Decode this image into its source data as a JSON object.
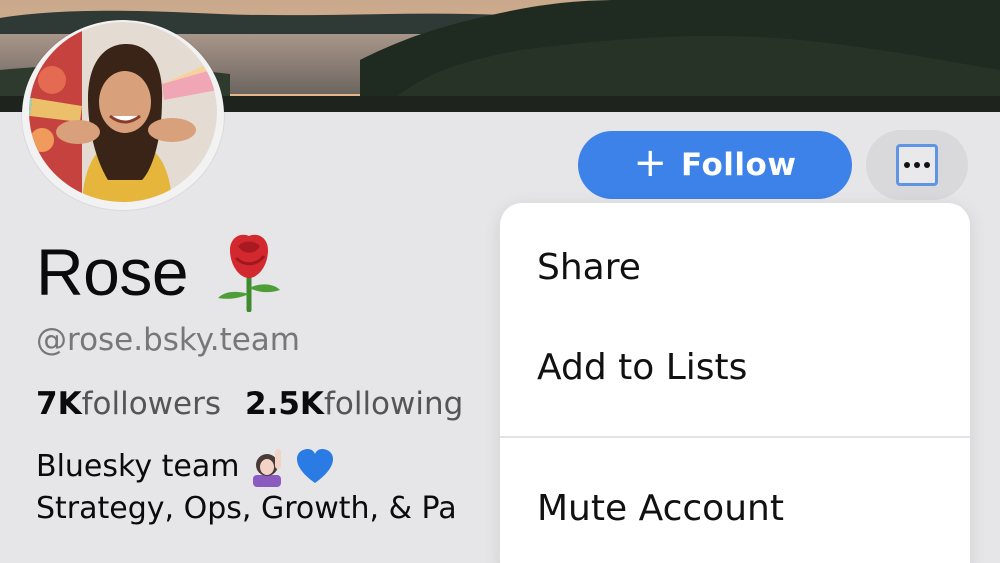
{
  "profile": {
    "display_name": "Rose",
    "name_emoji": "rose-emoji",
    "handle": "@rose.bsky.team",
    "followers_count": "7K",
    "followers_label": "followers",
    "following_count": "2.5K",
    "following_label": "following",
    "bio_line1": "Bluesky team",
    "bio_line1_emojis": [
      "person-raising-hand-emoji",
      "blue-heart-emoji"
    ],
    "bio_line2": "Strategy, Ops, Growth, & Pa"
  },
  "actions": {
    "follow_icon": "+",
    "follow_label": "Follow",
    "more_icon": "ellipsis-icon"
  },
  "menu": {
    "items": [
      {
        "label": "Share"
      },
      {
        "label": "Add to Lists"
      },
      {
        "label": "Mute Account"
      }
    ]
  },
  "colors": {
    "accent": "#3c82e8",
    "background": "#e6e6e8",
    "menu_bg": "#ffffff",
    "focus_ring": "#5f95e6"
  }
}
